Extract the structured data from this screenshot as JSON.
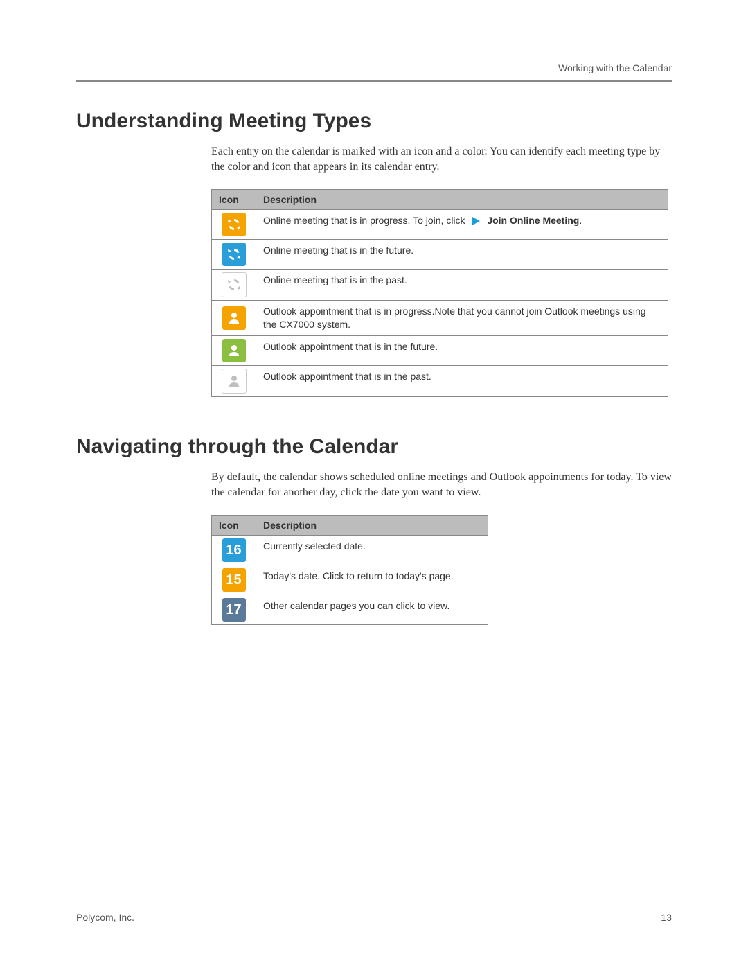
{
  "header": {
    "running_title": "Working with the Calendar"
  },
  "section1": {
    "title": "Understanding Meeting Types",
    "intro": "Each entry on the calendar is marked with an icon and a color. You can identify each meeting type by the color and icon that appears in its calendar entry.",
    "table": {
      "headers": {
        "icon": "Icon",
        "description": "Description"
      },
      "rows": [
        {
          "icon": {
            "type": "refresh",
            "color": "#f5a300"
          },
          "desc_pre": "Online meeting that is in progress. To join, click",
          "action_label": "Join Online Meeting",
          "desc_suffix": "."
        },
        {
          "icon": {
            "type": "refresh",
            "color": "#2a9ed8"
          },
          "desc": "Online meeting that is in the future."
        },
        {
          "icon": {
            "type": "refresh",
            "color": "#bfbfbf"
          },
          "desc": "Online meeting that is in the past."
        },
        {
          "icon": {
            "type": "person",
            "color": "#f5a300"
          },
          "desc": "Outlook appointment that is in progress.Note that you cannot join Outlook meetings using the CX7000 system."
        },
        {
          "icon": {
            "type": "person",
            "color": "#8bbf3f"
          },
          "desc": "Outlook appointment that is in the future."
        },
        {
          "icon": {
            "type": "person",
            "color": "#bfbfbf"
          },
          "desc": "Outlook appointment that is in the past."
        }
      ]
    }
  },
  "section2": {
    "title": "Navigating through the Calendar",
    "intro": "By default, the calendar shows scheduled online meetings and Outlook appointments for today. To view the calendar for another day, click the date you want to view.",
    "table": {
      "headers": {
        "icon": "Icon",
        "description": "Description"
      },
      "rows": [
        {
          "icon": {
            "type": "date",
            "color": "#2a9ed8",
            "value": "16"
          },
          "desc": "Currently selected date."
        },
        {
          "icon": {
            "type": "date",
            "color": "#f5a300",
            "value": "15"
          },
          "desc": "Today's date. Click to return to today's page."
        },
        {
          "icon": {
            "type": "date",
            "color": "#5b7a99",
            "value": "17"
          },
          "desc": "Other calendar pages you can click to view."
        }
      ]
    }
  },
  "footer": {
    "company": "Polycom, Inc.",
    "page_number": "13"
  },
  "icons": {
    "play_arrow_color": "#1aa0d8"
  }
}
